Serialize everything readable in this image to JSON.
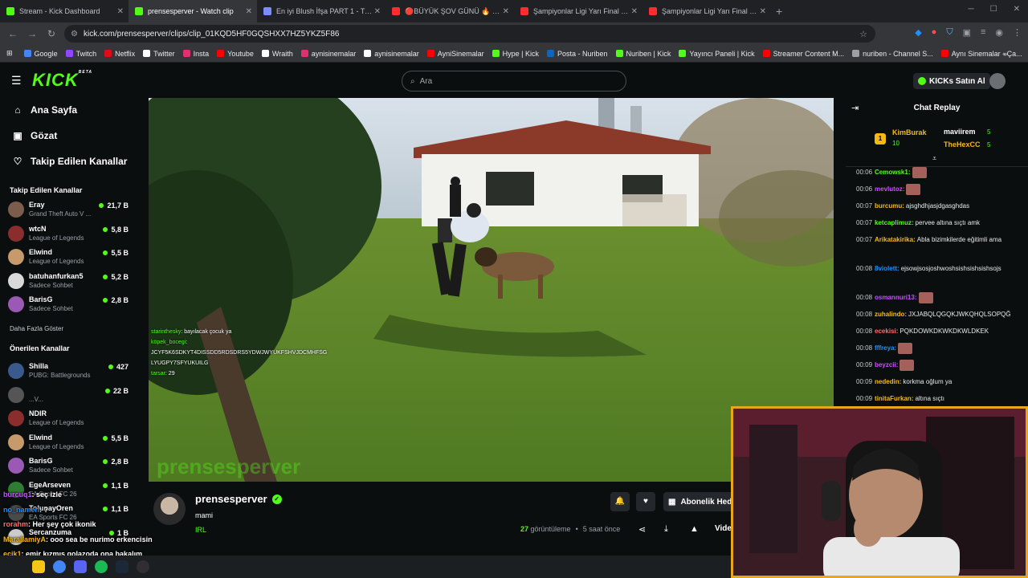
{
  "browser": {
    "tabs": [
      {
        "title": "Stream - Kick Dashboard",
        "color": "#53fc18"
      },
      {
        "title": "prensesperver - Watch clip",
        "color": "#53fc18"
      },
      {
        "title": "En iyi Blush İfşa PART 1 - Tier Li",
        "color": "#7b8cff"
      },
      {
        "title": "🔴BÜYÜK ŞOV GÜNÜ 🔥 I GR",
        "color": "#ff2d2d"
      },
      {
        "title": "Şampiyonlar Ligi Yarı Final | PSG",
        "color": "#ff2d2d"
      },
      {
        "title": "Şampiyonlar Ligi Yarı Final | Atl",
        "color": "#ff2d2d"
      }
    ],
    "url": "kick.com/prensesperver/clips/clip_01KQD5HF0GQSHXX7HZ5YKZ5F86",
    "bookmarks": [
      {
        "label": "Google",
        "color": "#4285f4"
      },
      {
        "label": "Twitch",
        "color": "#9146ff"
      },
      {
        "label": "Netflix",
        "color": "#e50914"
      },
      {
        "label": "Twitter",
        "color": "#ffffff"
      },
      {
        "label": "Insta",
        "color": "#e1306c"
      },
      {
        "label": "Youtube",
        "color": "#ff0000"
      },
      {
        "label": "Wraith",
        "color": "#ffffff"
      },
      {
        "label": "aynisinemalar",
        "color": "#e1306c"
      },
      {
        "label": "aynisinemalar",
        "color": "#ffffff"
      },
      {
        "label": "AyniSinemalar",
        "color": "#ff0000"
      },
      {
        "label": "Hype | Kick",
        "color": "#53fc18"
      },
      {
        "label": "Posta - Nuriben",
        "color": "#0a66c2"
      },
      {
        "label": "Nuriben | Kick",
        "color": "#53fc18"
      },
      {
        "label": "Yayıncı Paneli | Kick",
        "color": "#53fc18"
      },
      {
        "label": "Streamer Content M...",
        "color": "#ff0000"
      },
      {
        "label": "nuriben - Channel S...",
        "color": "#9aa0a6"
      },
      {
        "label": "Aynı Sinemalar - Ça...",
        "color": "#ff0000"
      }
    ]
  },
  "header": {
    "logo": "KICK",
    "logo_beta": "BETA",
    "search_placeholder": "Ara",
    "buy_kicks": "KICKs Satın Al"
  },
  "sidebar": {
    "nav": [
      {
        "label": "Ana Sayfa",
        "icon": "⌂"
      },
      {
        "label": "Gözat",
        "icon": "▣"
      },
      {
        "label": "Takip Edilen Kanallar",
        "icon": "♡"
      }
    ],
    "followed_title": "Takip Edilen Kanallar",
    "followed": [
      {
        "name": "Eray",
        "game": "Grand Theft Auto V ...",
        "count": "21,7 B",
        "color": "#7a5d4b"
      },
      {
        "name": "wtcN",
        "game": "League of Legends",
        "count": "5,8 B",
        "color": "#8a2d2d"
      },
      {
        "name": "Elwind",
        "game": "League of Legends",
        "count": "5,5 B",
        "color": "#c79a6b"
      },
      {
        "name": "batuhanfurkan5",
        "game": "Sadece Sohbet",
        "count": "5,2 B",
        "color": "#d9d9d9"
      },
      {
        "name": "BarisG",
        "game": "Sadece Sohbet",
        "count": "2,8 B",
        "color": "#9b59b6"
      }
    ],
    "show_more": "Daha Fazla Göster",
    "recommended_title": "Önerilen Kanallar",
    "recommended": [
      {
        "name": "Shilla",
        "game": "PUBG: Battlegrounds",
        "count": "427",
        "color": "#3a5a8c"
      },
      {
        "name": "",
        "game": "...V...",
        "count": "22 B",
        "color": "#555555"
      },
      {
        "name": "NDIR",
        "game": "League of Legends",
        "count": "",
        "color": "#8a2d2d"
      },
      {
        "name": "Elwind",
        "game": "League of Legends",
        "count": "5,5 B",
        "color": "#c79a6b"
      },
      {
        "name": "BarisG",
        "game": "Sadece Sohbet",
        "count": "2,8 B",
        "color": "#9b59b6"
      },
      {
        "name": "EgeArseven",
        "game": "EA Sports FC 26",
        "count": "1,1 B",
        "color": "#2e7d32"
      },
      {
        "name": "TolunayOren",
        "game": "EA Sports FC 26",
        "count": "1,1 B",
        "color": "#4a4a4a"
      },
      {
        "name": "Sercanzuma",
        "game": "",
        "count": "1 B",
        "color": "#cccccc"
      }
    ]
  },
  "video_chat": [
    {
      "user": "starinthesky",
      "text": ": bayılacak çocuk ya"
    },
    {
      "user": "köpek_bocegi",
      "text": ":"
    },
    {
      "user": "",
      "text": "JCYF5K6SDKYT4DISSDD5RDSDRS5YDWJWYUKFSHVJDCMHFSG"
    },
    {
      "user": "",
      "text": "LYUGPY7SFYUKUILG"
    },
    {
      "user": "tarsar",
      "text": ": 29"
    }
  ],
  "clip": {
    "channel": "prensesperver",
    "title": "mami",
    "tag": "IRL",
    "subscribe": "Abonelik Hediye Et",
    "views_num": "27",
    "views_label": "görüntüleme",
    "time_ago": "5 saat önce",
    "video_btn": "Video"
  },
  "chat": {
    "title": "Chat Replay",
    "leaderboard": [
      {
        "rank": "1",
        "name": "KimBurak",
        "pts": "10",
        "color": "#f5b916"
      },
      {
        "rank": "",
        "name": "maviirem",
        "pts": "5",
        "color": "#ffffff"
      },
      {
        "rank": "",
        "name": "TheHexCC",
        "pts": "5",
        "color": "#f5b916"
      }
    ],
    "messages": [
      {
        "time": "00:06",
        "user": "Cemowsk1:",
        "text": "",
        "color": "#53fc18",
        "emote": true
      },
      {
        "time": "00:06",
        "user": "mevlutoz:",
        "text": "",
        "color": "#c850ff",
        "emote": true
      },
      {
        "time": "00:07",
        "user": "burcumu:",
        "text": "ajsghdhjasjdgasghdas",
        "color": "#f5b916",
        "emote": false
      },
      {
        "time": "00:07",
        "user": "ketcaplimuz:",
        "text": "pervee altına sıçtı amk",
        "color": "#53fc18",
        "emote": false
      },
      {
        "time": "00:07",
        "user": "Arikatakirika:",
        "text": "Abla bizimkilerde eğitimli ama",
        "color": "#f5b916",
        "emote": false
      },
      {
        "time": "00:08",
        "user": "8violett:",
        "text": "ejsowjsosjoshwoshsishsishsishsojs",
        "color": "#1e90ff",
        "emote": false
      },
      {
        "time": "00:08",
        "user": "osmannuri13:",
        "text": "",
        "color": "#c850ff",
        "emote": true
      },
      {
        "time": "00:08",
        "user": "zuhalindo:",
        "text": "JXJABQLQGQKJWKQHQLSOPQĞ",
        "color": "#f5b916",
        "emote": false
      },
      {
        "time": "00:08",
        "user": "ecekisi:",
        "text": "PQKDOWKDKWKDKWLDKEK",
        "color": "#ff6b6b",
        "emote": false
      },
      {
        "time": "00:08",
        "user": "fffreya:",
        "text": "",
        "color": "#1e90ff",
        "emote": true
      },
      {
        "time": "00:09",
        "user": "beyzcii:",
        "text": "",
        "color": "#c850ff",
        "emote": true
      },
      {
        "time": "00:09",
        "user": "nededin:",
        "text": "korkma oğlum ya",
        "color": "#f5b916",
        "emote": false
      },
      {
        "time": "00:09",
        "user": "tinitaFurkan:",
        "text": "altına sıçtı",
        "color": "#f5b916",
        "emote": false
      }
    ]
  },
  "overlay_chat": [
    {
      "user": "burcuq1",
      "text": ": seç izle",
      "color": "#c850ff"
    },
    {
      "user": "no_namen",
      "text": ": ?",
      "color": "#1e90ff"
    },
    {
      "user": "rorahm",
      "text": ": Her şey çok ikonik",
      "color": "#ff6b6b"
    },
    {
      "user": "MaralIamiyA",
      "text": ": ooo sea be nurimo erkencisin",
      "color": "#f5b916"
    },
    {
      "user": "ecik1",
      "text": ": emir kızmış golazoda ona bakalım",
      "color": "#f5b916"
    },
    {
      "user": "no_namen",
      "text": ": bu iyi",
      "color": "#1e90ff"
    }
  ]
}
